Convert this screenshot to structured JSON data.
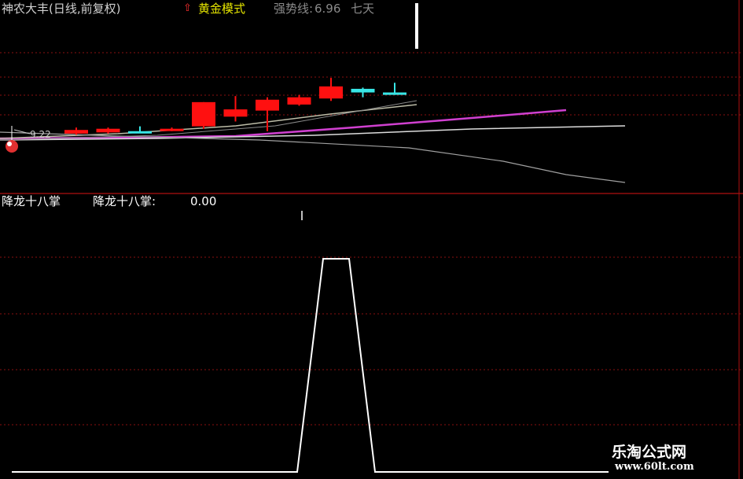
{
  "header": {
    "stock_title": "神农大丰(日线,前复权)",
    "mode_label": "黄金模式",
    "strength_label": "强势线:",
    "strength_value": "6.96",
    "days_label": "七天"
  },
  "main_panel": {
    "price_marker": "9.22",
    "colors": {
      "up_candle": "#ff1010",
      "cyan_candle": "#38e6e6",
      "ma_magenta": "#d040d0",
      "ma_white": "#dcdcdc",
      "ma_gray": "#a0a0a0",
      "grid": "#8a1010",
      "separator": "#b01010"
    },
    "candles": [
      {
        "color": "red",
        "open": 9.24,
        "close": 9.27,
        "high": 9.29,
        "low": 9.23
      },
      {
        "color": "red",
        "open": 9.25,
        "close": 9.28,
        "high": 9.29,
        "low": 9.24
      },
      {
        "color": "cyan",
        "open": 9.26,
        "close": 9.26,
        "high": 9.3,
        "low": 9.25
      },
      {
        "color": "red",
        "open": 9.27,
        "close": 9.28,
        "high": 9.29,
        "low": 9.26
      },
      {
        "color": "red",
        "open": 9.3,
        "close": 9.5,
        "high": 9.5,
        "low": 9.28
      },
      {
        "color": "red",
        "open": 9.38,
        "close": 9.44,
        "high": 9.55,
        "low": 9.34
      },
      {
        "color": "red",
        "open": 9.43,
        "close": 9.52,
        "high": 9.54,
        "low": 9.26
      },
      {
        "color": "red",
        "open": 9.48,
        "close": 9.54,
        "high": 9.56,
        "low": 9.47
      },
      {
        "color": "red",
        "open": 9.53,
        "close": 9.63,
        "high": 9.7,
        "low": 9.51
      },
      {
        "color": "cyan",
        "open": 9.58,
        "close": 9.61,
        "high": 9.62,
        "low": 9.54
      },
      {
        "color": "cyan",
        "open": 9.56,
        "close": 9.58,
        "high": 9.66,
        "low": 9.56
      }
    ]
  },
  "sub_panel": {
    "indicator_name": "降龙十八掌",
    "indicator_label": "降龙十八掌:",
    "indicator_value": "0.00",
    "signal_values": [
      0,
      0,
      0,
      0,
      0,
      0,
      0,
      0,
      0,
      0,
      0,
      0,
      1,
      1,
      0,
      0,
      0,
      0,
      0,
      0,
      0,
      0,
      0,
      0
    ]
  },
  "watermark": {
    "site_name": "乐淘公式网",
    "site_url": "www.60lt.com"
  }
}
